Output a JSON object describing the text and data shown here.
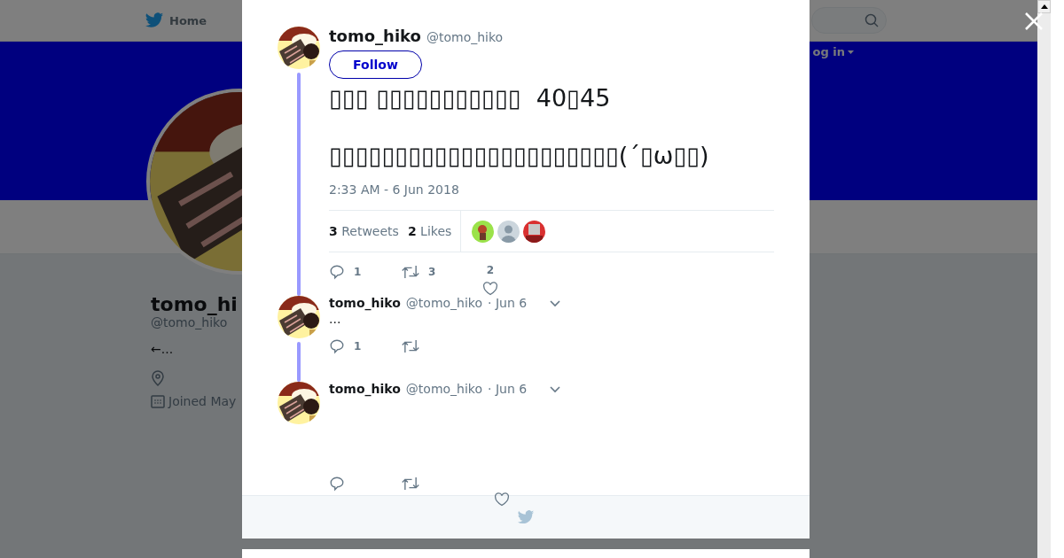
{
  "background_page": {
    "nav": {
      "home": "Home",
      "login": "og in"
    },
    "profile": {
      "name": "tomo_hi",
      "handle": "@tomo_hiko",
      "bio": "←...",
      "joined": "Joined May"
    }
  },
  "tweet": {
    "name": "tomo_hiko",
    "handle": "@tomo_hiko",
    "follow": "Follow",
    "text_lines": [
      "▯▯▯ ▯▯▯▯▯▯▯▯▯▯▯  40▯45",
      "▯▯▯▯▯▯▯▯▯▯▯▯▯▯▯▯▯▯▯▯▯▯(´▯ω▯▯)"
    ],
    "timestamp": "2:33 AM - 6 Jun 2018",
    "retweets": {
      "count": "3",
      "label": "Retweets"
    },
    "likes": {
      "count": "2",
      "label": "Likes"
    },
    "likers": [
      {
        "kind": "picture"
      },
      {
        "kind": "default"
      },
      {
        "kind": "picture"
      }
    ],
    "actions": {
      "reply": "1",
      "retweet": "3",
      "like": "2"
    }
  },
  "replies": [
    {
      "name": "tomo_hiko",
      "handle": "@tomo_hiko",
      "date": "· Jun 6",
      "text": "...",
      "reply_count": "1"
    },
    {
      "name": "tomo_hiko",
      "handle": "@tomo_hiko",
      "date": "· Jun 6"
    }
  ]
}
